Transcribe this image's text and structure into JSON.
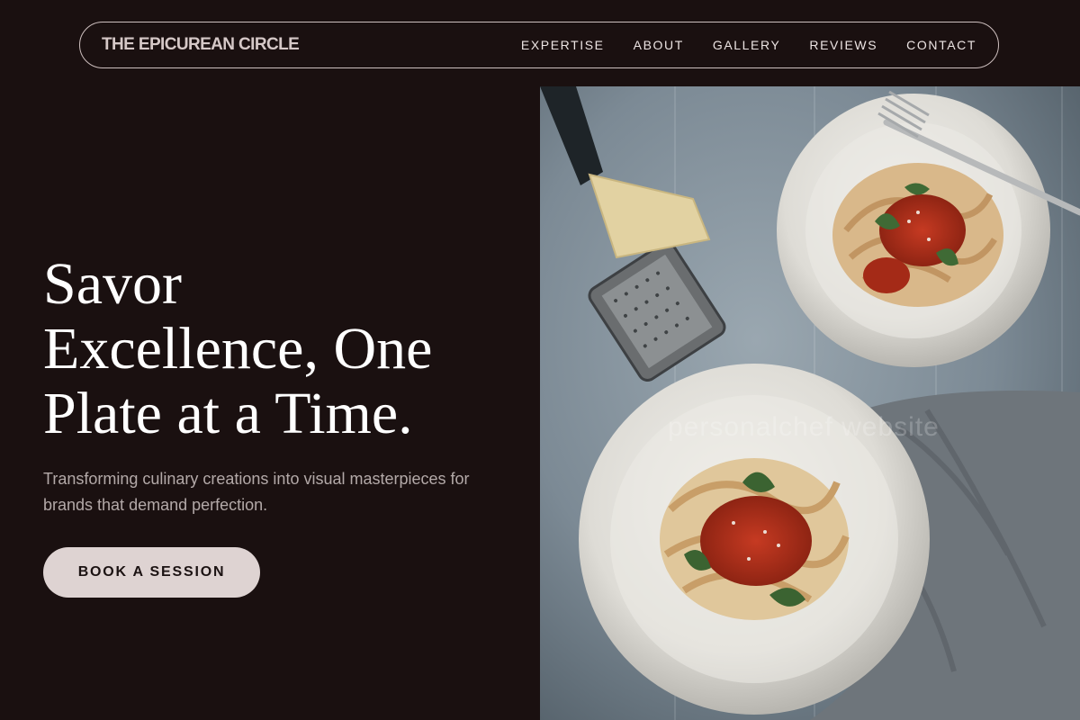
{
  "header": {
    "brand": "THE EPICUREAN CIRCLE",
    "nav": [
      {
        "label": "EXPERTISE"
      },
      {
        "label": "ABOUT"
      },
      {
        "label": "GALLERY"
      },
      {
        "label": "REVIEWS"
      },
      {
        "label": "CONTACT"
      }
    ]
  },
  "hero": {
    "title_lines": [
      "Savor",
      "Excellence, One",
      "Plate at a Time."
    ],
    "subtitle_lines": [
      "Transforming culinary creations into visual masterpieces for",
      "brands that demand perfection."
    ],
    "cta_label": "BOOK A SESSION"
  },
  "image": {
    "subject": "pasta-dishes-photo",
    "watermark": "personalchef website"
  },
  "colors": {
    "background": "#1a1010",
    "button": "#ded3d2",
    "text_muted": "#b3a9a8"
  }
}
